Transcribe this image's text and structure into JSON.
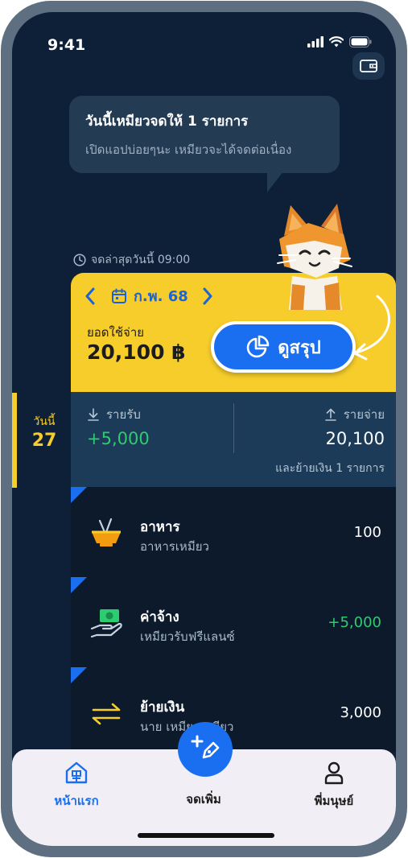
{
  "status_bar": {
    "time": "9:41"
  },
  "bubble": {
    "title": "วันนี้เหมียวจดให้  1  รายการ",
    "subtitle": "เปิดแอปบ่อยๆนะ เหมียวจะได้จดต่อเนื่อง"
  },
  "last_recorded": "จดล่าสุดวันนี้  09:00",
  "day": {
    "label": "วันนี้",
    "number": "27"
  },
  "month_selector": {
    "label": "ก.พ. 68"
  },
  "spending": {
    "label": "ยอดใช้จ่าย",
    "value": "20,100 ฿"
  },
  "summary_button": {
    "label": "ดูสรุป"
  },
  "income": {
    "label": "รายรับ",
    "value": "+5,000"
  },
  "expense": {
    "label": "รายจ่าย",
    "value": "20,100"
  },
  "transfer_note": "และย้ายเงิน 1 รายการ",
  "transactions": [
    {
      "title": "อาหาร",
      "subtitle": "อาหารเหมียว",
      "amount": "100",
      "icon": "food-bowl-icon"
    },
    {
      "title": "ค่าจ้าง",
      "subtitle": "เหมียวรับฟรีแลนซ์",
      "amount": "+5,000",
      "icon": "salary-money-icon"
    },
    {
      "title": "ย้ายเงิน",
      "subtitle": "นาย เหมียวเหมียว",
      "amount": "3,000",
      "icon": "transfer-arrows-icon"
    }
  ],
  "nav": {
    "home": "หน้าแรก",
    "add": "จดเพิ่ม",
    "profile": "พี่มนุษย์"
  },
  "colors": {
    "background": "#0e2038",
    "accent": "#1a6ff0",
    "yellow": "#f6cd2a",
    "income_green": "#2ecc71"
  }
}
